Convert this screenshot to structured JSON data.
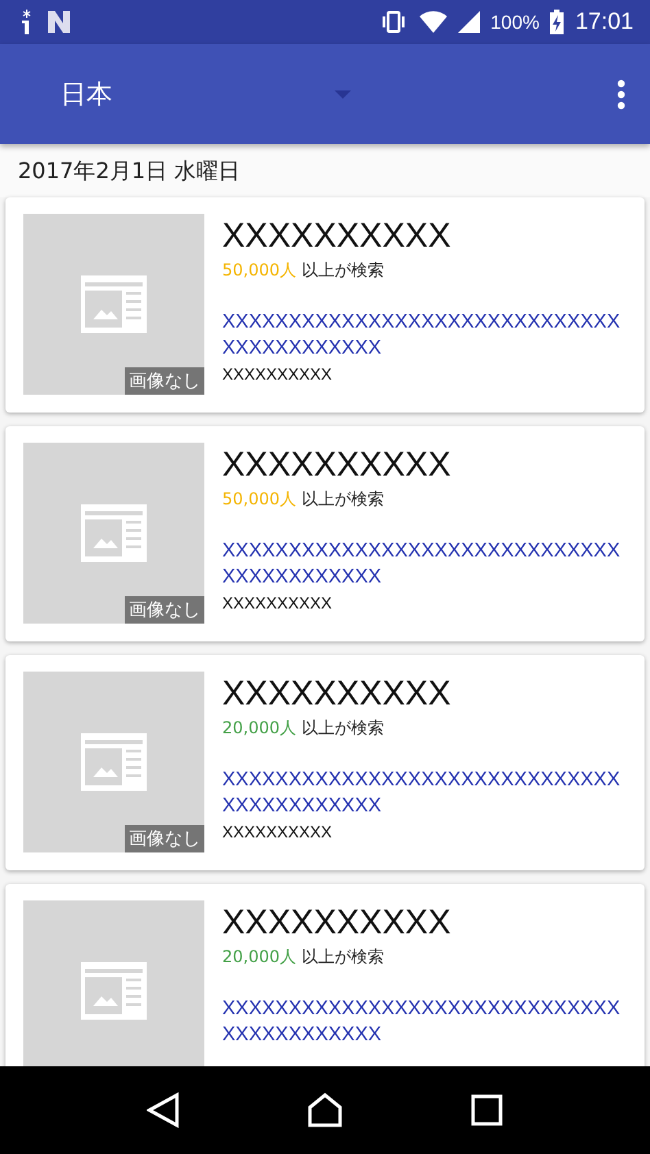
{
  "status_bar": {
    "battery": "100%",
    "time": "17:01"
  },
  "app_bar": {
    "title": "日本"
  },
  "date": "2017年2月1日 水曜日",
  "cards": [
    {
      "title": "XXXXXXXXXX",
      "count": "50,000人",
      "color": "#f4b400",
      "count_suffix": "以上が検索",
      "link": "XXXXXXXXXXXXXXXXXXXXXXXXXXXXXXXXXXXXXXXXXX",
      "source": "XXXXXXXXXX",
      "image_label": "画像なし"
    },
    {
      "title": "XXXXXXXXXX",
      "count": "50,000人",
      "color": "#f4b400",
      "count_suffix": "以上が検索",
      "link": "XXXXXXXXXXXXXXXXXXXXXXXXXXXXXXXXXXXXXXXXXX",
      "source": "XXXXXXXXXX",
      "image_label": "画像なし"
    },
    {
      "title": "XXXXXXXXXX",
      "count": "20,000人",
      "color": "#43a047",
      "count_suffix": "以上が検索",
      "link": "XXXXXXXXXXXXXXXXXXXXXXXXXXXXXXXXXXXXXXXXXX",
      "source": "XXXXXXXXXX",
      "image_label": "画像なし"
    },
    {
      "title": "XXXXXXXXXX",
      "count": "20,000人",
      "color": "#43a047",
      "count_suffix": "以上が検索",
      "link": "XXXXXXXXXXXXXXXXXXXXXXXXXXXXXXXXXXXXXXXXXX"
    }
  ]
}
